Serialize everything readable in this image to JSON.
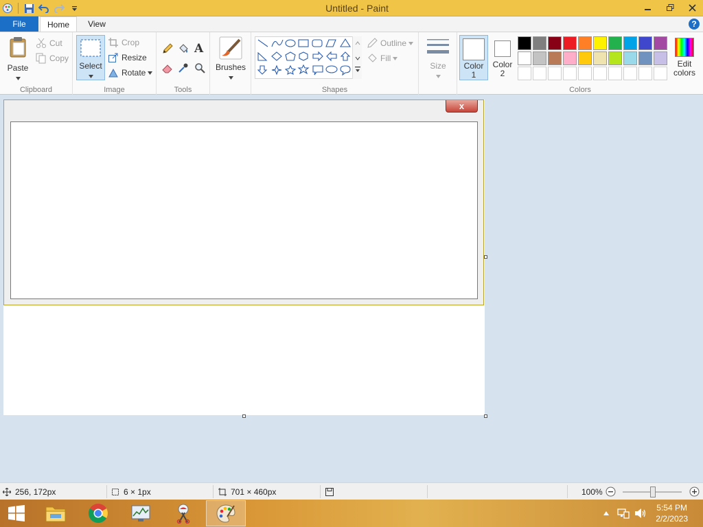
{
  "window": {
    "title": "Untitled - Paint"
  },
  "tabs": [
    {
      "label": "File"
    },
    {
      "label": "Home"
    },
    {
      "label": "View"
    }
  ],
  "help_label": "?",
  "ribbon": {
    "clipboard": {
      "label": "Clipboard",
      "paste": "Paste",
      "cut": "Cut",
      "copy": "Copy"
    },
    "image": {
      "label": "Image",
      "select": "Select",
      "crop": "Crop",
      "resize": "Resize",
      "rotate": "Rotate"
    },
    "tools": {
      "label": "Tools",
      "text_glyph": "A"
    },
    "brushes": {
      "label": "Brushes"
    },
    "shapes": {
      "label": "Shapes",
      "outline": "Outline",
      "fill": "Fill"
    },
    "size": {
      "label": "Size"
    },
    "colors": {
      "label": "Colors",
      "color1": "Color 1",
      "color2": "Color 2",
      "edit": "Edit colors",
      "palette_row1": [
        "#000000",
        "#7f7f7f",
        "#880015",
        "#ed1c24",
        "#ff7f27",
        "#fff200",
        "#22b14c",
        "#00a2e8",
        "#3f48cc",
        "#a349a4"
      ],
      "palette_row2": [
        "#ffffff",
        "#c3c3c3",
        "#b97a57",
        "#ffaec9",
        "#ffc90e",
        "#efe4b0",
        "#b5e61d",
        "#99d9ea",
        "#7092be",
        "#c8bfe7"
      ]
    }
  },
  "dialog": {
    "close_label": "x"
  },
  "status": {
    "cursor_pos": "256, 172px",
    "selection_size": "6 × 1px",
    "image_size": "701 × 460px",
    "zoom": "100%"
  },
  "taskbar": {
    "time": "5:54 PM",
    "date": "2/2/2023"
  }
}
